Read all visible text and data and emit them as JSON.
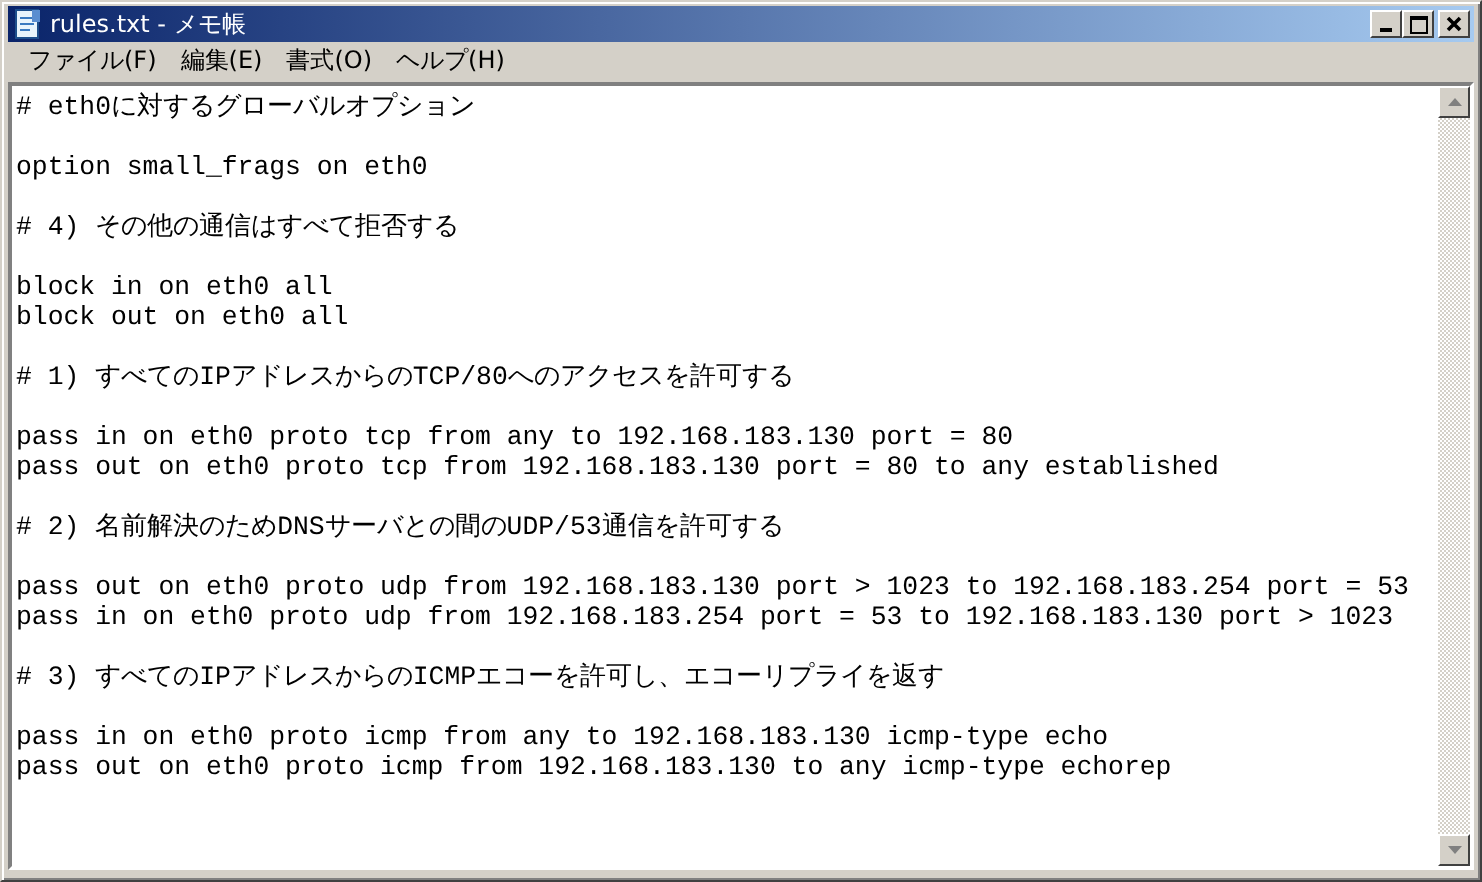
{
  "window": {
    "title": "rules.txt - メモ帳"
  },
  "menu": [
    "ファイル(F)",
    "編集(E)",
    "書式(O)",
    "ヘルプ(H)"
  ],
  "document": {
    "blocks": [
      [
        "# eth0に対するグローバルオプション"
      ],
      [
        "option small_frags on eth0"
      ],
      [
        "# 4) その他の通信はすべて拒否する"
      ],
      [
        "block in on eth0 all",
        "block out on eth0 all"
      ],
      [
        "# 1) すべてのIPアドレスからのTCP/80へのアクセスを許可する"
      ],
      [
        "pass in on eth0 proto tcp from any to 192.168.183.130 port = 80",
        "pass out on eth0 proto tcp from 192.168.183.130 port = 80 to any established"
      ],
      [
        "# 2) 名前解決のためDNSサーバとの間のUDP/53通信を許可する"
      ],
      [
        "pass out on eth0 proto udp from 192.168.183.130 port > 1023 to 192.168.183.254 port = 53",
        "pass in on eth0 proto udp from 192.168.183.254 port = 53 to 192.168.183.130 port > 1023"
      ],
      [
        "# 3) すべてのIPアドレスからのICMPエコーを許可し、エコーリプライを返す"
      ],
      [
        "pass in on eth0 proto icmp from any to 192.168.183.130 icmp-type echo",
        "pass out on eth0 proto icmp from 192.168.183.130 to any icmp-type echorep"
      ]
    ]
  }
}
